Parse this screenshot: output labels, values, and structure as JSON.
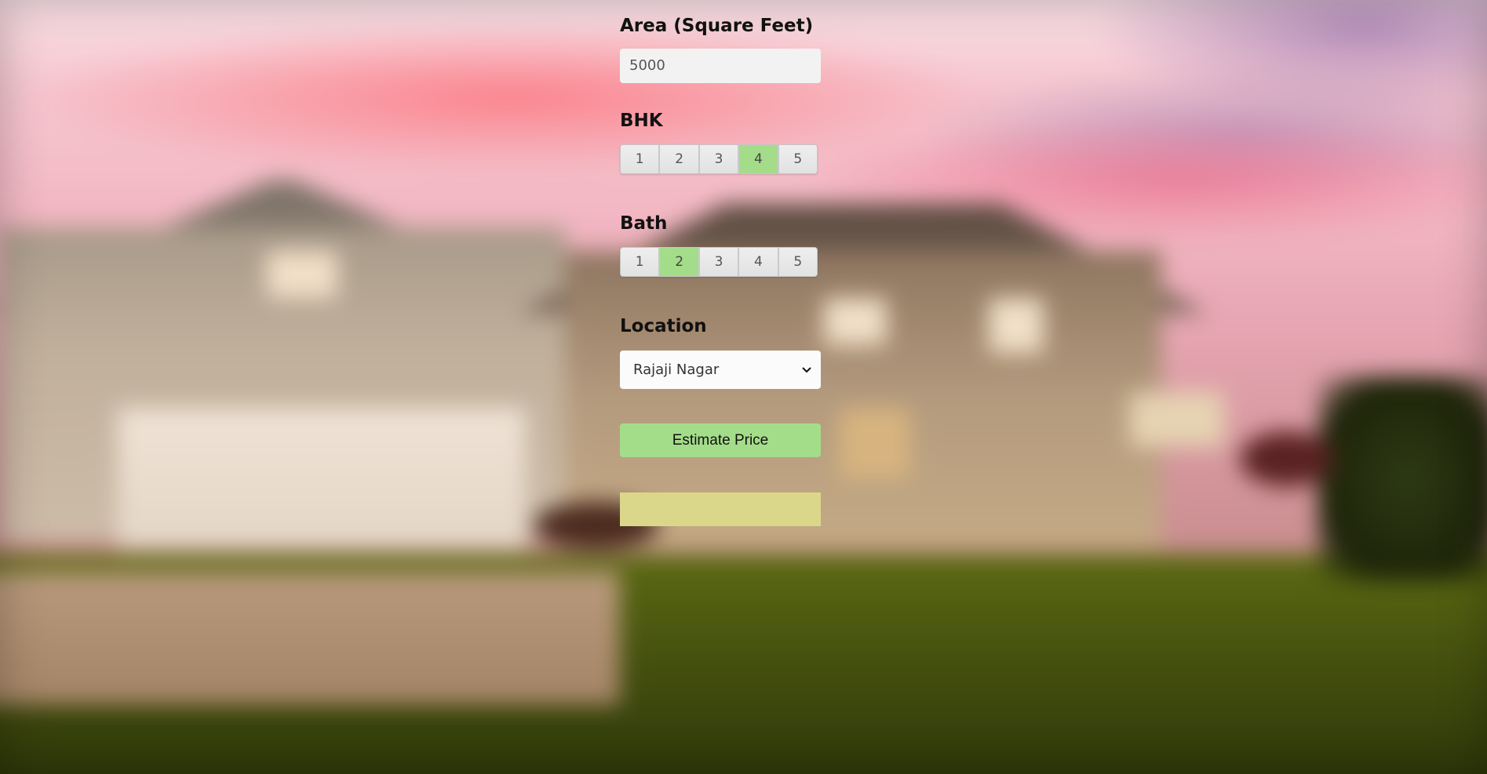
{
  "form": {
    "area": {
      "label": "Area (Square Feet)",
      "value": "5000"
    },
    "bhk": {
      "label": "BHK",
      "options": [
        "1",
        "2",
        "3",
        "4",
        "5"
      ],
      "selected": "4"
    },
    "bath": {
      "label": "Bath",
      "options": [
        "1",
        "2",
        "3",
        "4",
        "5"
      ],
      "selected": "2"
    },
    "location": {
      "label": "Location",
      "selected": "Rajaji Nagar"
    },
    "estimate_button_label": "Estimate Price",
    "result_text": ""
  },
  "colors": {
    "selected_option": "#a4dd8a",
    "button": "#a4dd8a",
    "result_box": "#dbd78a"
  },
  "icons": {
    "location_dropdown": "chevron-down-icon"
  }
}
